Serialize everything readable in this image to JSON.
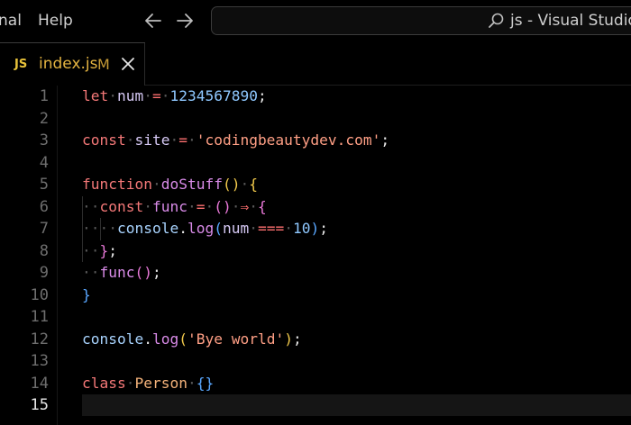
{
  "titlebar": {
    "menu": [
      {
        "label": "nal"
      },
      {
        "label": "Help"
      }
    ],
    "command_center_title": "js - Visual Studio C"
  },
  "tabs": [
    {
      "lang_badge": "JS",
      "name": "index.js",
      "status": "M"
    }
  ],
  "editor": {
    "active_line": 15,
    "line_numbers": [
      "1",
      "2",
      "3",
      "4",
      "5",
      "6",
      "7",
      "8",
      "9",
      "10",
      "11",
      "12",
      "13",
      "14",
      "15"
    ],
    "lines": {
      "l1": {
        "kw": "let",
        "var": "num",
        "op": "=",
        "num": "1234567890",
        "end": ";"
      },
      "l3": {
        "kw": "const",
        "var": "site",
        "op": "=",
        "str": "'codingbeautydev.com'",
        "end": ";"
      },
      "l5": {
        "kw": "function",
        "fn": "doStuff",
        "paren": "()",
        "brace": "{"
      },
      "l6": {
        "kw": "const",
        "fn": "func",
        "op": "=",
        "paren": "()",
        "arrow": "⇒",
        "brace": "{"
      },
      "l7": {
        "obj": "console",
        "dot": ".",
        "fn": "log",
        "open": "(",
        "var": "num",
        "op": "===",
        "num": "10",
        "close": ")",
        "end": ";"
      },
      "l8": {
        "brace": "}",
        "end": ";"
      },
      "l9": {
        "fn": "func",
        "paren": "()",
        "end": ";"
      },
      "l10": {
        "brace": "}"
      },
      "l12": {
        "obj": "console",
        "dot": ".",
        "fn": "log",
        "open": "(",
        "str": "'Bye world'",
        "close": ")",
        "end": ";"
      },
      "l14": {
        "kw": "class",
        "cls": "Person",
        "brace": "{}"
      }
    }
  },
  "colors": {
    "background": "#000000",
    "keyword": "#f47878",
    "function": "#d98be8",
    "number": "#8fc8ff",
    "string": "#ff9f85",
    "tab_label": "#e3b341"
  }
}
